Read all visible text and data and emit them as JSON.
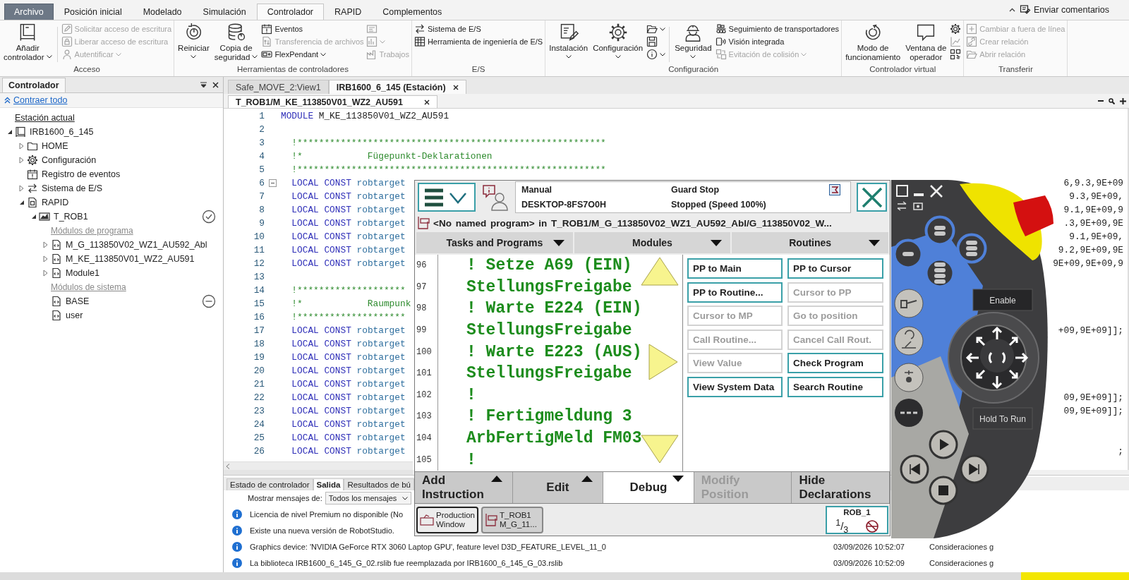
{
  "ribbon": {
    "tabs": [
      {
        "label": "Archivo",
        "kind": "file",
        "selected": false
      },
      {
        "label": "Posición inicial",
        "kind": "tab",
        "selected": false
      },
      {
        "label": "Modelado",
        "kind": "tab",
        "selected": false
      },
      {
        "label": "Simulación",
        "kind": "tab",
        "selected": false
      },
      {
        "label": "Controlador",
        "kind": "tab",
        "selected": true
      },
      {
        "label": "RAPID",
        "kind": "tab",
        "selected": false
      },
      {
        "label": "Complementos",
        "kind": "tab",
        "selected": false
      }
    ],
    "feedback": "Enviar comentarios",
    "groups": [
      {
        "label": "Acceso",
        "items": [
          {
            "kind": "large",
            "lines": [
              "Añadir",
              "controlador"
            ],
            "dropdown": true,
            "disabled": false
          },
          {
            "kind": "stack",
            "items": [
              {
                "label": "Solicitar acceso de escritura",
                "disabled": true,
                "dropdown": false
              },
              {
                "label": "Liberar acceso de escritura",
                "disabled": true,
                "dropdown": false
              },
              {
                "label": "Autentificar",
                "disabled": true,
                "dropdown": true
              }
            ]
          }
        ]
      },
      {
        "label": "Herramientas de controladores",
        "items": [
          {
            "kind": "large",
            "lines": [
              "Reiniciar"
            ],
            "dropdown": true,
            "disabled": false
          },
          {
            "kind": "large",
            "lines": [
              "Copia de",
              "seguridad"
            ],
            "dropdown": true,
            "disabled": false
          },
          {
            "kind": "stack",
            "items": [
              {
                "label": "Eventos",
                "disabled": false,
                "dropdown": false
              },
              {
                "label": "Transferencia de archivos",
                "disabled": true,
                "dropdown": false
              },
              {
                "label": "FlexPendant",
                "disabled": false,
                "dropdown": true
              }
            ]
          },
          {
            "kind": "stack",
            "items": [
              {
                "disabled": true,
                "dropdown": false
              },
              {
                "disabled": true,
                "dropdown": true
              },
              {
                "label": "Trabajos",
                "disabled": true,
                "dropdown": false
              }
            ]
          }
        ]
      },
      {
        "label": "E/S",
        "items": [
          {
            "kind": "stack",
            "items": [
              {
                "label": "Sistema de E/S",
                "disabled": false,
                "dropdown": false
              },
              {
                "label": "Herramienta de ingeniería de E/S",
                "disabled": false,
                "dropdown": false
              }
            ]
          }
        ]
      },
      {
        "label": "Configuración",
        "items": [
          {
            "kind": "large",
            "lines": [
              "Instalación"
            ],
            "dropdown": true,
            "disabled": false
          },
          {
            "kind": "large",
            "lines": [
              "Configuración"
            ],
            "dropdown": true,
            "disabled": false
          },
          {
            "kind": "stack",
            "items": [
              {
                "disabled": false,
                "dropdown": true
              },
              {
                "disabled": false,
                "dropdown": false
              },
              {
                "disabled": false,
                "dropdown": true
              }
            ]
          },
          {
            "kind": "large",
            "lines": [
              "Seguridad"
            ],
            "dropdown": true,
            "disabled": false
          },
          {
            "kind": "stack",
            "items": [
              {
                "label": "Seguimiento de transportadores",
                "disabled": false,
                "dropdown": false
              },
              {
                "label": "Visión integrada",
                "disabled": false,
                "dropdown": false
              },
              {
                "label": "Evitación de colisión",
                "disabled": true,
                "dropdown": true
              }
            ]
          }
        ]
      },
      {
        "label": "Controlador virtual",
        "items": [
          {
            "kind": "large",
            "lines": [
              "Modo de",
              "funcionamiento"
            ],
            "dropdown": false,
            "disabled": false
          },
          {
            "kind": "large",
            "lines": [
              "Ventana de",
              "operador"
            ],
            "dropdown": false,
            "disabled": false
          },
          {
            "kind": "stack",
            "items": [
              {
                "disabled": false,
                "dropdown": false
              },
              {
                "disabled": true,
                "dropdown": false
              },
              {
                "disabled": false,
                "dropdown": false
              }
            ]
          }
        ]
      },
      {
        "label": "Transferir",
        "items": [
          {
            "kind": "stack",
            "items": [
              {
                "label": "Cambiar a fuera de línea",
                "disabled": true,
                "dropdown": false
              },
              {
                "label": "Crear relación",
                "disabled": true,
                "dropdown": false
              },
              {
                "label": "Abrir relación",
                "disabled": true,
                "dropdown": false
              }
            ]
          }
        ]
      }
    ]
  },
  "left_panel": {
    "title": "Controlador",
    "collapse_link": "Contraer todo",
    "tree": [
      {
        "label": "Estación actual",
        "kind": "caption"
      },
      {
        "label": "IRB1600_6_145",
        "kind": "station",
        "expanded": true,
        "children": [
          {
            "label": "HOME",
            "kind": "folder",
            "expanded": false
          },
          {
            "label": "Configuración",
            "kind": "config",
            "expanded": false
          },
          {
            "label": "Registro de eventos",
            "kind": "events"
          },
          {
            "label": "Sistema de E/S",
            "kind": "io",
            "expanded": false
          },
          {
            "label": "RAPID",
            "kind": "rapid",
            "expanded": true,
            "children": [
              {
                "label": "T_ROB1",
                "kind": "task",
                "expanded": true,
                "checked": true,
                "children": [
                  {
                    "label": "Módulos de programa",
                    "kind": "heading"
                  },
                  {
                    "label": "M_G_113850V02_WZ1_AU592_Abl",
                    "kind": "module",
                    "expanded": false
                  },
                  {
                    "label": "M_KE_113850V01_WZ2_AU591",
                    "kind": "module",
                    "expanded": false
                  },
                  {
                    "label": "Module1",
                    "kind": "module",
                    "expanded": false
                  },
                  {
                    "label": "Módulos de sistema",
                    "kind": "heading"
                  },
                  {
                    "label": "BASE",
                    "kind": "module",
                    "excluded": true
                  },
                  {
                    "label": "user",
                    "kind": "module"
                  }
                ]
              }
            ]
          }
        ]
      }
    ]
  },
  "editor": {
    "doc_tabs": [
      {
        "label": "Safe_MOVE_2:View1",
        "selected": false
      },
      {
        "label": "IRB1600_6_145 (Estación)",
        "selected": true
      }
    ],
    "file_tab": "T_ROB1/M_KE_113850V01_WZ2_AU591",
    "lines": [
      {
        "number": "1",
        "code": [
          {
            "kind": "keyword",
            "text": "MODULE"
          },
          {
            "kind": "plain",
            "text": " M_KE_113850V01_WZ2_AU591"
          }
        ]
      },
      {
        "number": "2"
      },
      {
        "number": "3",
        "code": [
          {
            "kind": "comment",
            "text": "  !*********************************************************"
          }
        ]
      },
      {
        "number": "4",
        "code": [
          {
            "kind": "comment",
            "text": "  !*            Fügepunkt-Deklarationen"
          }
        ]
      },
      {
        "number": "5",
        "code": [
          {
            "kind": "comment",
            "text": "  !*********************************************************"
          }
        ]
      },
      {
        "number": "6",
        "fold_expanded": true,
        "code": [
          {
            "kind": "keyword",
            "text": "  LOCAL CONST"
          },
          {
            "kind": "type",
            "text": " robtarget"
          }
        ],
        "tail": "6,9.3,9E+09"
      },
      {
        "number": "7",
        "code": [
          {
            "kind": "keyword",
            "text": "  LOCAL CONST"
          },
          {
            "kind": "type",
            "text": " robtarget"
          }
        ],
        "tail": "9.3,9E+09,"
      },
      {
        "number": "8",
        "code": [
          {
            "kind": "keyword",
            "text": "  LOCAL CONST"
          },
          {
            "kind": "type",
            "text": " robtarget"
          }
        ],
        "tail": "9.1,9E+09,9"
      },
      {
        "number": "9",
        "code": [
          {
            "kind": "keyword",
            "text": "  LOCAL CONST"
          },
          {
            "kind": "type",
            "text": " robtarget"
          }
        ],
        "tail": ".3,9E+09,9E"
      },
      {
        "number": "10",
        "code": [
          {
            "kind": "keyword",
            "text": "  LOCAL CONST"
          },
          {
            "kind": "type",
            "text": " robtarget"
          }
        ],
        "tail": "9.1,9E+09,"
      },
      {
        "number": "11",
        "code": [
          {
            "kind": "keyword",
            "text": "  LOCAL CONST"
          },
          {
            "kind": "type",
            "text": " robtarget"
          }
        ],
        "tail": "9.2,9E+09,9E"
      },
      {
        "number": "12",
        "code": [
          {
            "kind": "keyword",
            "text": "  LOCAL CONST"
          },
          {
            "kind": "type",
            "text": " robtarget"
          }
        ],
        "tail": "9E+09,9E+09,9"
      },
      {
        "number": "13"
      },
      {
        "number": "14",
        "code": [
          {
            "kind": "comment",
            "text": "  !********************"
          }
        ]
      },
      {
        "number": "15",
        "code": [
          {
            "kind": "comment",
            "text": "  !*            Raumpunk"
          }
        ]
      },
      {
        "number": "16",
        "code": [
          {
            "kind": "comment",
            "text": "  !********************"
          }
        ]
      },
      {
        "number": "17",
        "code": [
          {
            "kind": "keyword",
            "text": "  LOCAL CONST"
          },
          {
            "kind": "type",
            "text": " robtarget"
          }
        ],
        "tail": "+09,9E+09]];"
      },
      {
        "number": "18",
        "code": [
          {
            "kind": "keyword",
            "text": "  LOCAL CONST"
          },
          {
            "kind": "type",
            "text": " robtarget"
          }
        ]
      },
      {
        "number": "19",
        "code": [
          {
            "kind": "keyword",
            "text": "  LOCAL CONST"
          },
          {
            "kind": "type",
            "text": " robtarget"
          }
        ]
      },
      {
        "number": "20",
        "code": [
          {
            "kind": "keyword",
            "text": "  LOCAL CONST"
          },
          {
            "kind": "type",
            "text": " robtarget"
          }
        ]
      },
      {
        "number": "21",
        "code": [
          {
            "kind": "keyword",
            "text": "  LOCAL CONST"
          },
          {
            "kind": "type",
            "text": " robtarget"
          }
        ]
      },
      {
        "number": "22",
        "code": [
          {
            "kind": "keyword",
            "text": "  LOCAL CONST"
          },
          {
            "kind": "type",
            "text": " robtarget"
          }
        ],
        "tail": "09,9E+09]];"
      },
      {
        "number": "23",
        "code": [
          {
            "kind": "keyword",
            "text": "  LOCAL CONST"
          },
          {
            "kind": "type",
            "text": " robtarget"
          }
        ],
        "tail": "09,9E+09]];"
      },
      {
        "number": "24",
        "code": [
          {
            "kind": "keyword",
            "text": "  LOCAL CONST"
          },
          {
            "kind": "type",
            "text": " robtarget"
          }
        ]
      },
      {
        "number": "25",
        "code": [
          {
            "kind": "keyword",
            "text": "  LOCAL CONST"
          },
          {
            "kind": "type",
            "text": " robtarget"
          }
        ]
      },
      {
        "number": "26",
        "code": [
          {
            "kind": "keyword",
            "text": "  LOCAL CONST"
          },
          {
            "kind": "type",
            "text": " robtarget"
          }
        ],
        "tail": ";"
      }
    ]
  },
  "output": {
    "tabs": [
      {
        "label": "Estado de controlador",
        "selected": false
      },
      {
        "label": "Salida",
        "selected": true
      },
      {
        "label": "Resultados de bú",
        "selected": false
      }
    ],
    "filter_label": "Mostrar mensajes de:",
    "filter_value": "Todos los mensajes",
    "messages": [
      {
        "text": "Licencia de nivel Premium no disponible (No"
      },
      {
        "text": "Existe una nueva versión de RobotStudio."
      },
      {
        "text": "Graphics device: 'NVIDIA GeForce RTX 3060 Laptop GPU', feature level D3D_FEATURE_LEVEL_11_0",
        "time": "03/09/2026 10:52:07",
        "category": "Consideraciones g"
      },
      {
        "text": "La biblioteca IRB1600_6_145_G_02.rslib fue reemplazada por IRB1600_6_145_G_03.rslib",
        "time": "03/09/2026 10:52:09",
        "category": "Consideraciones g"
      }
    ]
  },
  "flexpendant": {
    "status": {
      "mode": "Manual",
      "system": "DESKTOP-8FS7O0H",
      "state": "Guard Stop",
      "speed": "Stopped (Speed 100%)"
    },
    "program_path": "<No named program> in T_ROB1/M_G_113850V02_WZ1_AU592_Abl/G_113850V02_W...",
    "selectors": [
      "Tasks and Programs",
      "Modules",
      "Routines"
    ],
    "lines": [
      {
        "number": "96",
        "text": "! Setze A69 (EIN)"
      },
      {
        "number": "97",
        "text": "StellungsFreigabe"
      },
      {
        "number": "98",
        "text": "! Warte E224 (EIN)"
      },
      {
        "number": "99",
        "text": "StellungsFreigabe"
      },
      {
        "number": "100",
        "text": "! Warte E223 (AUS)"
      },
      {
        "number": "101",
        "text": "StellungsFreigabe"
      },
      {
        "number": "102",
        "text": "!"
      },
      {
        "number": "103",
        "text": "! Fertigmeldung 3"
      },
      {
        "number": "104",
        "text": "ArbFertigMeld FM03"
      },
      {
        "number": "105",
        "text": "!"
      }
    ],
    "actions": [
      {
        "label": "PP to Main",
        "disabled": false
      },
      {
        "label": "PP to Cursor",
        "disabled": false
      },
      {
        "label": "PP to Routine...",
        "disabled": false
      },
      {
        "label": "Cursor to PP",
        "disabled": true
      },
      {
        "label": "Cursor to MP",
        "disabled": true
      },
      {
        "label": "Go to position",
        "disabled": true
      },
      {
        "label": "Call Routine...",
        "disabled": true
      },
      {
        "label": "Cancel Call Rout.",
        "disabled": true
      },
      {
        "label": "View Value",
        "disabled": true
      },
      {
        "label": "Check Program",
        "disabled": false
      },
      {
        "label": "View System Data",
        "disabled": false
      },
      {
        "label": "Search Routine",
        "disabled": false
      }
    ],
    "menu": [
      {
        "lines": [
          "Add",
          "Instruction"
        ],
        "kind": "upmenu",
        "selected": false,
        "disabled": false
      },
      {
        "lines": [
          "Edit"
        ],
        "kind": "upmenu",
        "selected": false,
        "disabled": false
      },
      {
        "lines": [
          "Debug"
        ],
        "kind": "downmenu",
        "selected": true,
        "disabled": false
      },
      {
        "lines": [
          "Modify",
          "Position"
        ],
        "kind": "button",
        "selected": false,
        "disabled": true
      },
      {
        "lines": [
          "Hide",
          "Declarations"
        ],
        "kind": "button",
        "selected": false,
        "disabled": false
      }
    ],
    "taskbar": [
      {
        "lines": [
          "Production",
          "Window"
        ],
        "selected": true
      },
      {
        "lines": [
          "T_ROB1",
          "M_G_11..."
        ],
        "selected": false
      }
    ],
    "robot": {
      "name": "ROB_1",
      "fraction": "$^{1}$/$_{3}$"
    }
  },
  "jog_panel": {
    "enable_label": "Enable",
    "hold_label": "Hold To Run"
  }
}
